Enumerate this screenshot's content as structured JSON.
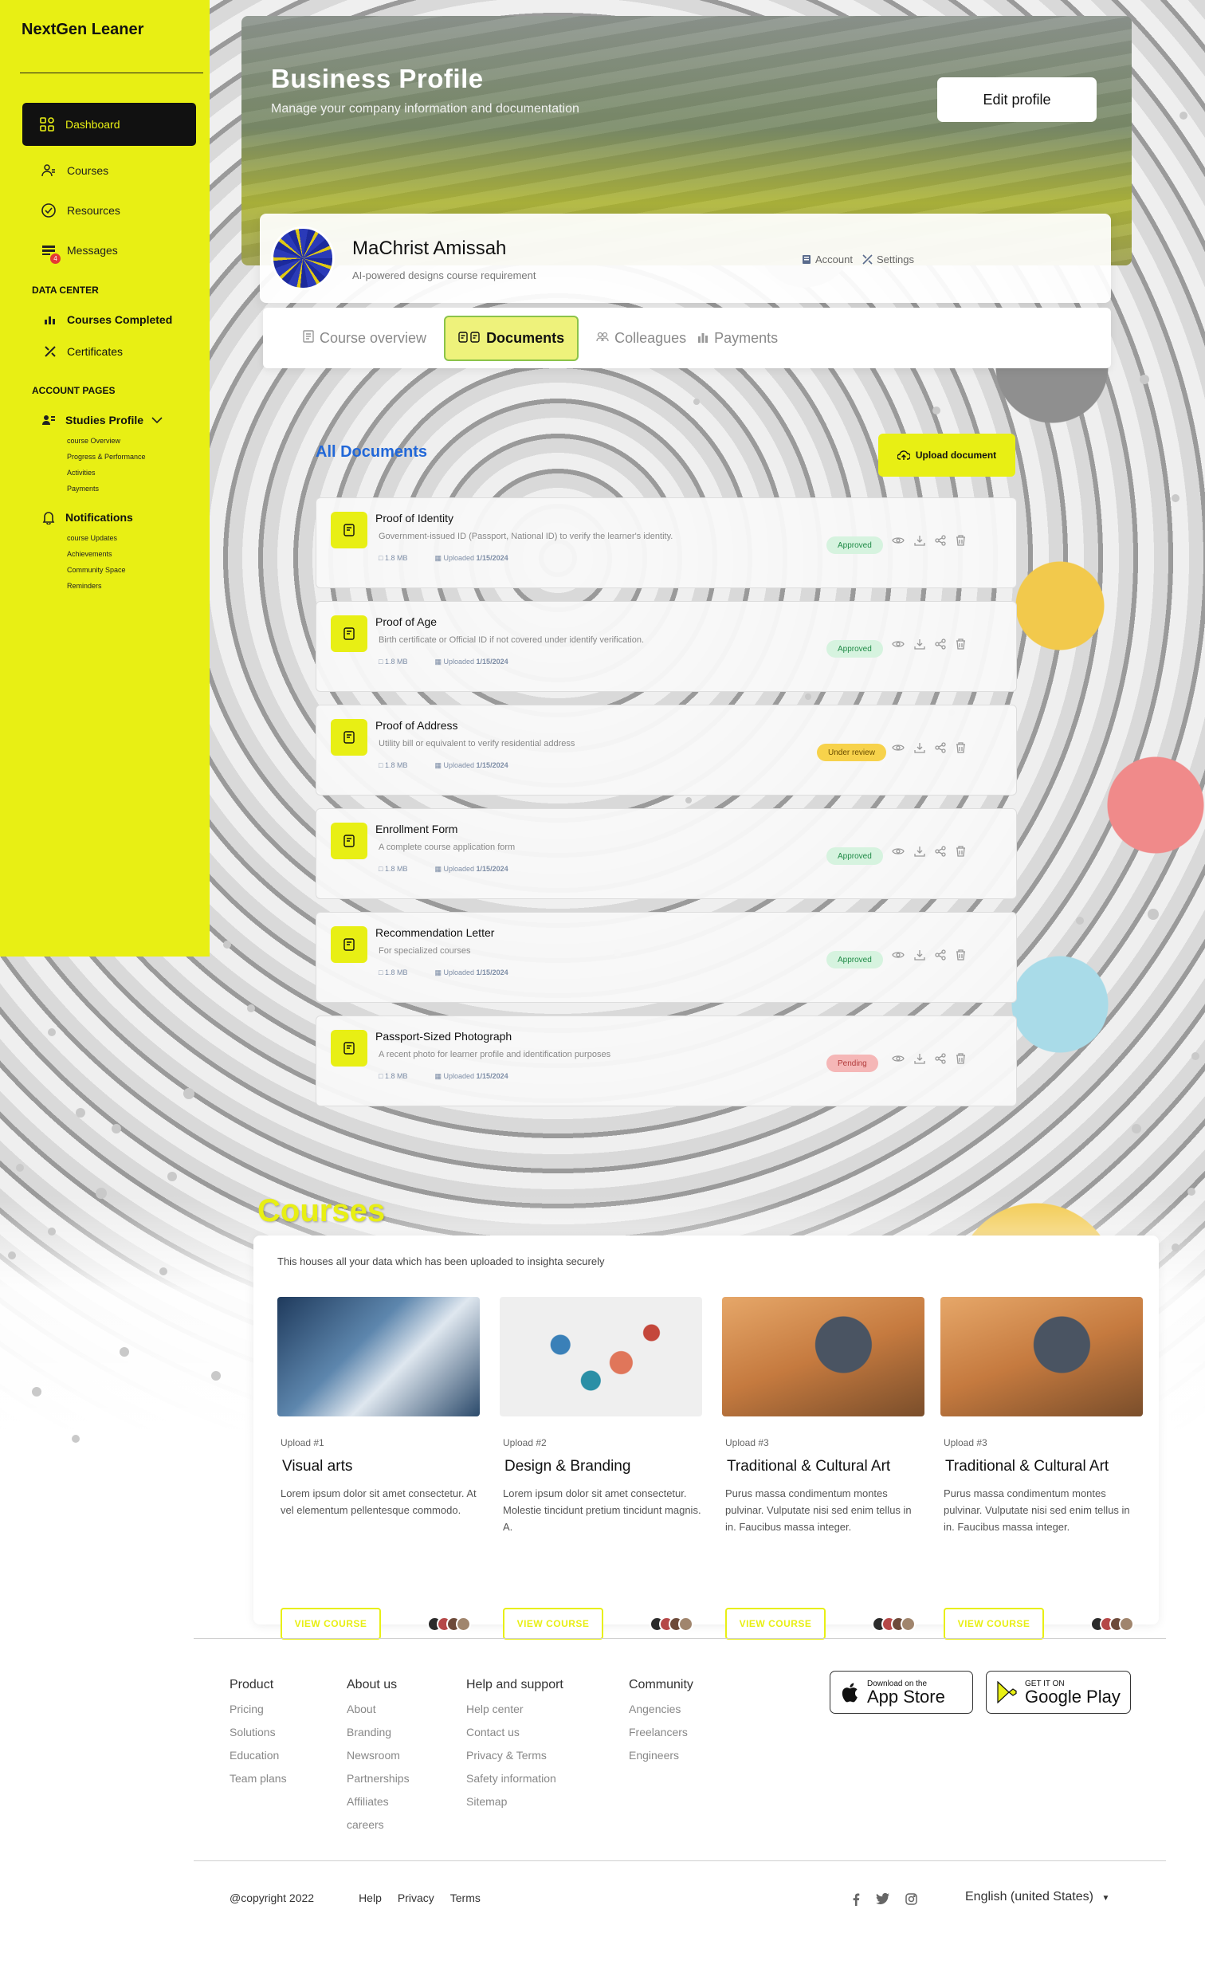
{
  "brand": "NextGen Leaner",
  "sidebar": {
    "items": [
      {
        "label": "Dashboard",
        "icon": "dashboard-icon"
      },
      {
        "label": "Courses",
        "icon": "courses-icon"
      },
      {
        "label": "Resources",
        "icon": "resources-icon"
      },
      {
        "label": "Messages",
        "icon": "messages-icon",
        "badge": "4"
      }
    ],
    "data_center_heading": "DATA CENTER",
    "data_center": [
      {
        "label": "Courses Completed",
        "icon": "chart-icon"
      },
      {
        "label": "Certificates",
        "icon": "tools-icon"
      }
    ],
    "account_heading": "ACCOUNT PAGES",
    "studies_profile": {
      "label": "Studies Profile",
      "children": [
        "course Overview",
        "Progress & Performance",
        "Activities",
        "Payments"
      ]
    },
    "notifications": {
      "label": "Notifications",
      "children": [
        "course Updates",
        "Achievements",
        "Community Space",
        "Reminders"
      ]
    }
  },
  "header": {
    "title": "Business Profile",
    "subtitle": "Manage your company information and documentation",
    "edit_button": "Edit profile"
  },
  "profile": {
    "name": "MaChrist Amissah",
    "role": "AI-powered designs course requirement",
    "account_link": "Account",
    "settings_link": "Settings"
  },
  "tabs": [
    {
      "label": "Course overview",
      "active": false
    },
    {
      "label": "Documents",
      "active": true
    },
    {
      "label": "Colleagues",
      "active": false
    },
    {
      "label": "Payments",
      "active": false
    }
  ],
  "documents": {
    "heading": "All Documents",
    "upload_button": "Upload document",
    "items": [
      {
        "title": "Proof of Identity",
        "description": "Government-issued ID (Passport, National ID) to verify the learner's identity.",
        "size": "1.8 MB",
        "uploaded_label": "Uploaded",
        "date": "1/15/2024",
        "status": "Approved"
      },
      {
        "title": "Proof of Age",
        "description": "Birth certificate or Official ID if not covered under identify verification.",
        "size": "1.8 MB",
        "uploaded_label": "Uploaded",
        "date": "1/15/2024",
        "status": "Approved"
      },
      {
        "title": "Proof of Address",
        "description": "Utility bill or equivalent to verify residential address",
        "size": "1.8 MB",
        "uploaded_label": "Uploaded",
        "date": "1/15/2024",
        "status": "Under review"
      },
      {
        "title": "Enrollment Form",
        "description": "A complete course application form",
        "size": "1.8 MB",
        "uploaded_label": "Uploaded",
        "date": "1/15/2024",
        "status": "Approved"
      },
      {
        "title": "Recommendation Letter",
        "description": "For specialized courses",
        "size": "1.8 MB",
        "uploaded_label": "Uploaded",
        "date": "1/15/2024",
        "status": "Approved"
      },
      {
        "title": "Passport-Sized Photograph",
        "description": "A recent photo for learner profile and identification purposes",
        "size": "1.8 MB",
        "uploaded_label": "Uploaded",
        "date": "1/15/2024",
        "status": "Pending"
      }
    ]
  },
  "courses": {
    "title": "Courses",
    "intro": "This houses all your data which has been uploaded to insighta securely",
    "items": [
      {
        "tag": "Upload #1",
        "title": "Visual arts",
        "description": "Lorem ipsum dolor sit amet consectetur. At vel elementum pellentesque commodo.",
        "button": "VIEW COURSE"
      },
      {
        "tag": "Upload #2",
        "title": "Design & Branding",
        "description": "Lorem ipsum dolor sit amet consectetur. Molestie tincidunt pretium tincidunt magnis. A.",
        "button": "VIEW COURSE"
      },
      {
        "tag": "Upload #3",
        "title": "Traditional & Cultural Art",
        "description": "Purus massa condimentum montes pulvinar. Vulputate nisi sed enim tellus in in. Faucibus massa integer.",
        "button": "VIEW COURSE"
      },
      {
        "tag": "Upload #3",
        "title": "Traditional & Cultural Art",
        "description": "Purus massa condimentum montes pulvinar. Vulputate nisi sed enim tellus in in. Faucibus massa integer.",
        "button": "VIEW COURSE"
      }
    ]
  },
  "footer": {
    "columns": [
      {
        "heading": "Product",
        "links": [
          "Pricing",
          "Solutions",
          "Education",
          "Team plans"
        ]
      },
      {
        "heading": "About us",
        "links": [
          "About",
          "Branding",
          "Newsroom",
          "Partnerships",
          "Affiliates",
          "careers"
        ]
      },
      {
        "heading": "Help and support",
        "links": [
          "Help center",
          "Contact us",
          "Privacy & Terms",
          "Safety information",
          "Sitemap"
        ]
      },
      {
        "heading": "Community",
        "links": [
          "Angencies",
          "Freelancers",
          "Engineers"
        ]
      }
    ],
    "app_store": {
      "small": "Download on the",
      "big": "App Store"
    },
    "google_play": {
      "small": "GET IT ON",
      "big": "Google Play"
    },
    "copyright": "@copyright 2022",
    "bottom_links": [
      "Help",
      "Privacy",
      "Terms"
    ],
    "language": "English (united States)"
  },
  "colors": {
    "accent": "#e8ef14",
    "link_blue": "#2167d8",
    "approved": "#d6f3df",
    "under_review": "#f7d24b",
    "pending": "#f5b7b7"
  }
}
